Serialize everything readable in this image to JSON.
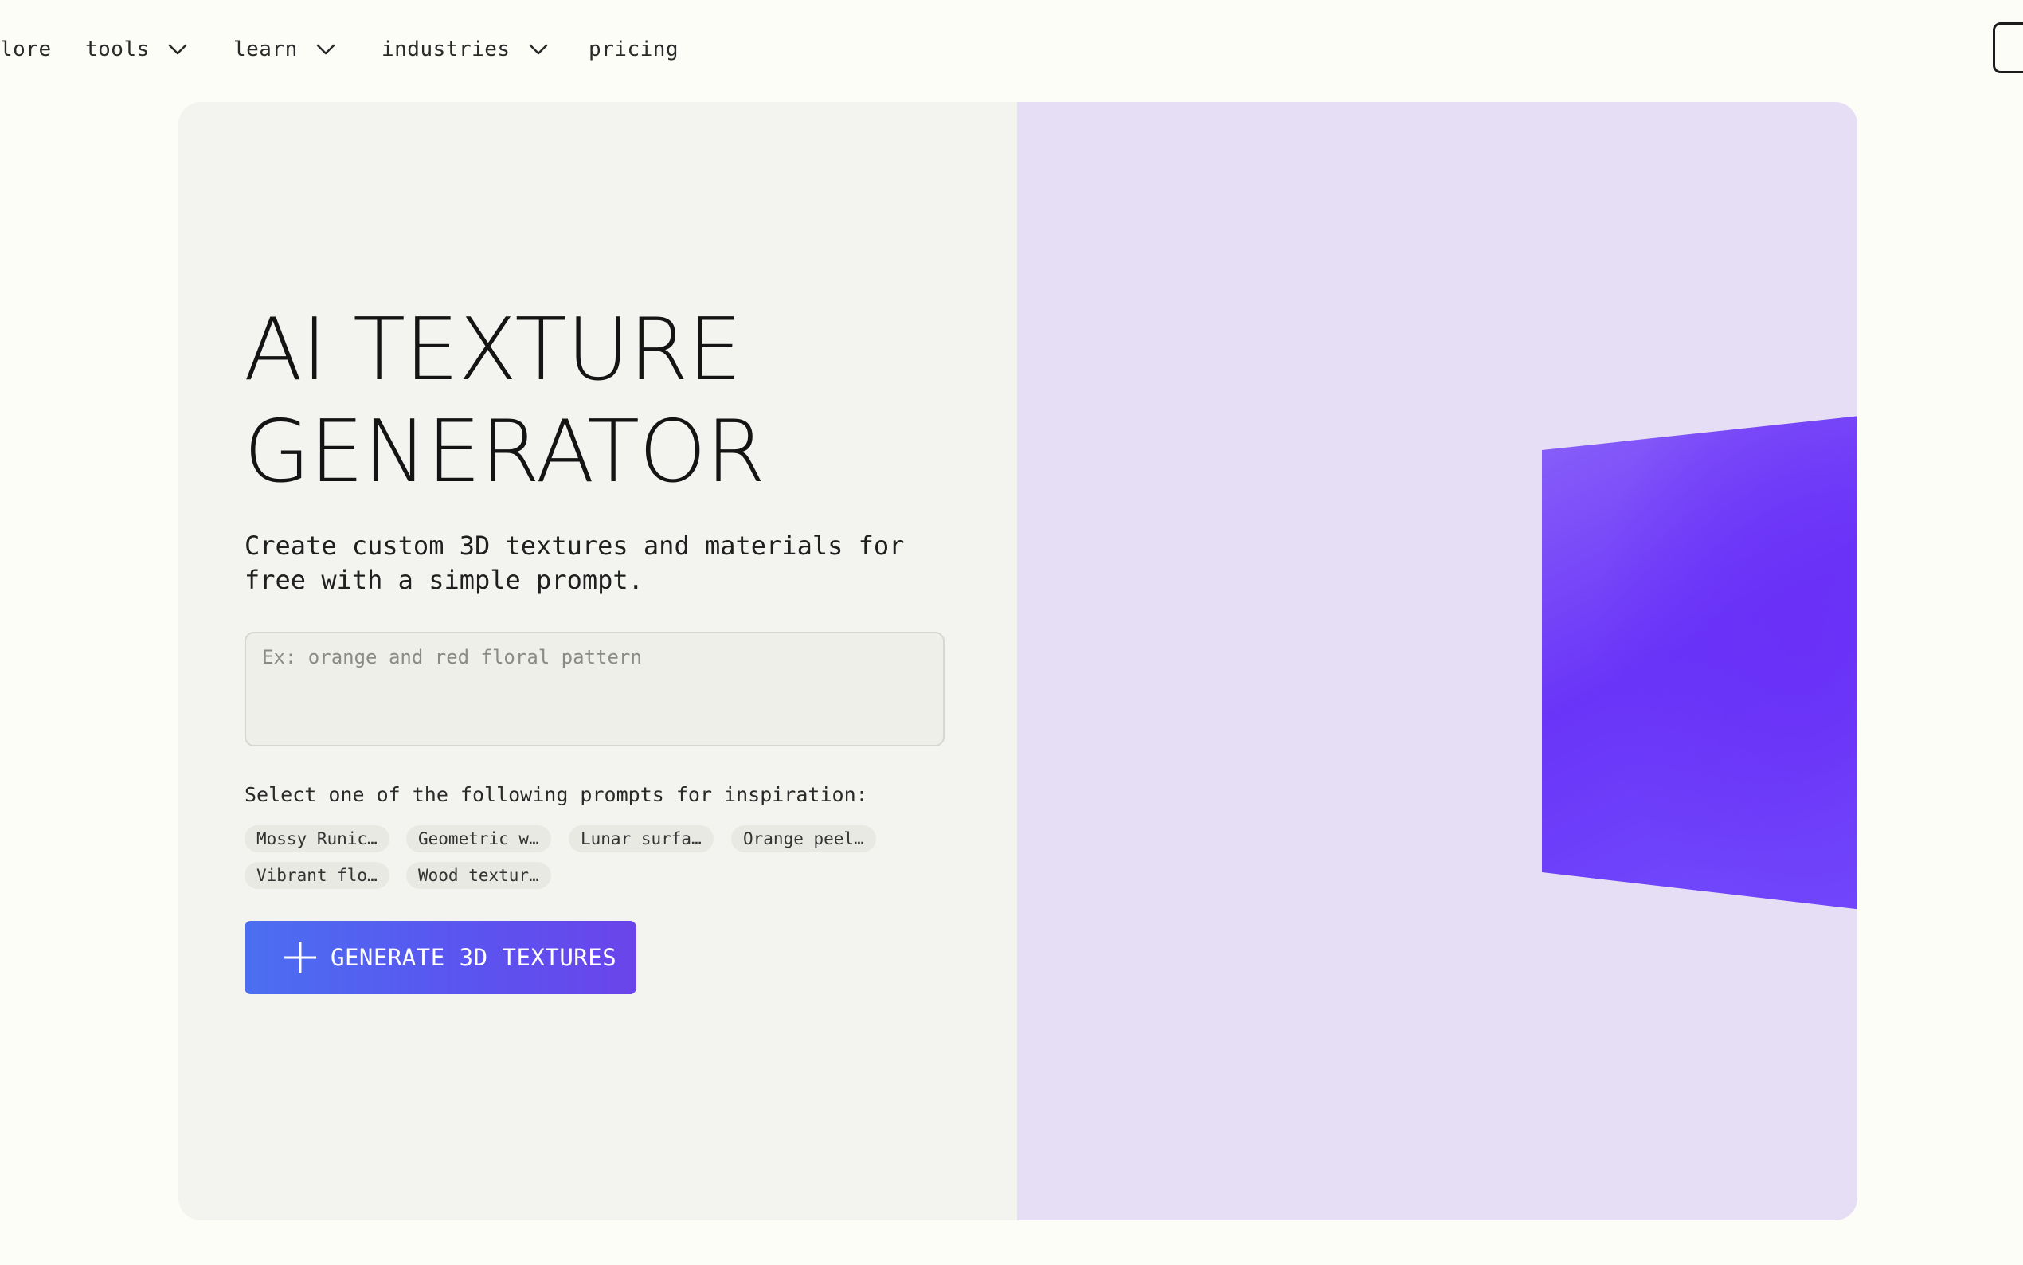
{
  "nav": {
    "items": [
      {
        "label": "lore",
        "has_dropdown": false
      },
      {
        "label": "tools",
        "has_dropdown": true
      },
      {
        "label": "learn",
        "has_dropdown": true
      },
      {
        "label": "industries",
        "has_dropdown": true
      },
      {
        "label": "pricing",
        "has_dropdown": false
      }
    ]
  },
  "hero": {
    "title_line1": "AI TEXTURE",
    "title_line2": "GENERATOR",
    "subtitle": "Create custom 3D textures and materials for free with a simple prompt.",
    "prompt_placeholder": "Ex: orange and red floral pattern",
    "prompt_value": "",
    "inspiration_label": "Select one of the following prompts for inspiration:",
    "chips": [
      "Mossy Runic…",
      "Geometric w…",
      "Lunar surfa…",
      "Orange peel…",
      "Vibrant flo…",
      "Wood textur…"
    ],
    "generate_label": "GENERATE 3D TEXTURES",
    "generate_icon": "plus-icon"
  },
  "preview": {
    "object": "cube-preview",
    "colors": {
      "panel_background": "#e6def5",
      "cube_front": "#6b3ef7",
      "cube_side": "#6a3cf6"
    }
  },
  "colors": {
    "page_background": "#fdfdf8",
    "left_panel": "#f3f3f0",
    "button_gradient_start": "#4b6ff0",
    "button_gradient_end": "#6a44ea"
  }
}
